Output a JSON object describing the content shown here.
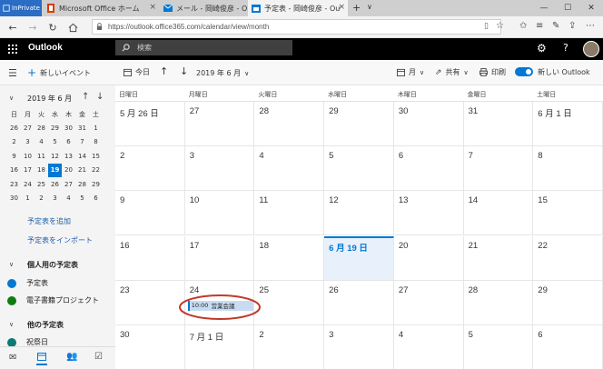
{
  "browser": {
    "inprivate": "InPrivate",
    "tabs": [
      {
        "title": "Microsoft Office ホーム"
      },
      {
        "title": "メール - 岡崎俊彦 - Outlook"
      },
      {
        "title": "予定表 - 岡崎俊彦 - Outl"
      }
    ],
    "url": "https://outlook.office365.com/calendar/view/month"
  },
  "outlook": {
    "app_name": "Outlook",
    "search_placeholder": "検索",
    "new_event": "新しいイベント",
    "today": "今日",
    "month_title": "2019 年 6 月",
    "view": "月",
    "share": "共有",
    "print": "印刷",
    "new_outlook": "新しい Outlook",
    "toggle_on": true
  },
  "sidebar": {
    "mini_title": "2019 年 6 月",
    "weekdays": [
      "日",
      "月",
      "火",
      "水",
      "木",
      "金",
      "土"
    ],
    "weeks": [
      [
        "26",
        "27",
        "28",
        "29",
        "30",
        "31",
        "1"
      ],
      [
        "2",
        "3",
        "4",
        "5",
        "6",
        "7",
        "8"
      ],
      [
        "9",
        "10",
        "11",
        "12",
        "13",
        "14",
        "15"
      ],
      [
        "16",
        "17",
        "18",
        "19",
        "20",
        "21",
        "22"
      ],
      [
        "23",
        "24",
        "25",
        "26",
        "27",
        "28",
        "29"
      ],
      [
        "30",
        "1",
        "2",
        "3",
        "4",
        "5",
        "6"
      ]
    ],
    "today_day": "19",
    "add_calendar": "予定表を追加",
    "import_calendar": "予定表をインポート",
    "personal_group": "個人用の予定表",
    "calendars": [
      {
        "name": "予定表",
        "color": "#0078d4"
      },
      {
        "name": "電子書籍プロジェクト",
        "color": "#107c10"
      }
    ],
    "other_group": "他の予定表",
    "other_item": "祝祭日"
  },
  "calendar": {
    "weekday_headers": [
      "日曜日",
      "月曜日",
      "火曜日",
      "水曜日",
      "木曜日",
      "金曜日",
      "土曜日"
    ],
    "weeks": [
      [
        "5 月 26 日",
        "27",
        "28",
        "29",
        "30",
        "31",
        "6 月 1 日"
      ],
      [
        "2",
        "3",
        "4",
        "5",
        "6",
        "7",
        "8"
      ],
      [
        "9",
        "10",
        "11",
        "12",
        "13",
        "14",
        "15"
      ],
      [
        "16",
        "17",
        "18",
        "6 月 19 日",
        "20",
        "21",
        "22"
      ],
      [
        "23",
        "24",
        "25",
        "26",
        "27",
        "28",
        "29"
      ],
      [
        "30",
        "7 月 1 日",
        "2",
        "3",
        "4",
        "5",
        "6"
      ]
    ],
    "today_label": "6 月 19 日",
    "event": {
      "time": "10:00",
      "title": "営業会議"
    },
    "accent": "#0078d4",
    "annotation_color": "#c0392b"
  }
}
